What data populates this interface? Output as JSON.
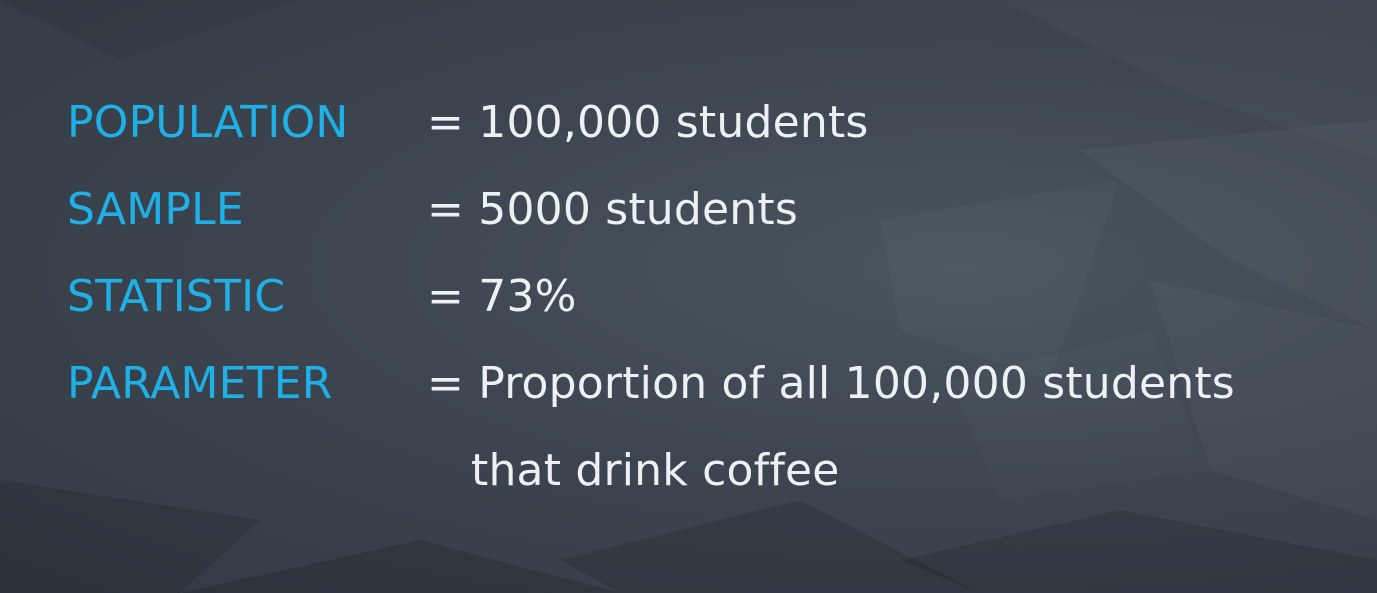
{
  "slide": {
    "rows": [
      {
        "term": "POPULATION",
        "value": "= 100,000 students"
      },
      {
        "term": "SAMPLE",
        "value": "= 5000 students"
      },
      {
        "term": "STATISTIC",
        "value": "= 73%"
      },
      {
        "term": "PARAMETER",
        "value": "= Proportion of all 100,000 students"
      }
    ],
    "parameter_continuation": "that drink coffee"
  },
  "colors": {
    "term": "#1eb0e6",
    "value": "#eef1f3",
    "background": "#3b4550"
  }
}
